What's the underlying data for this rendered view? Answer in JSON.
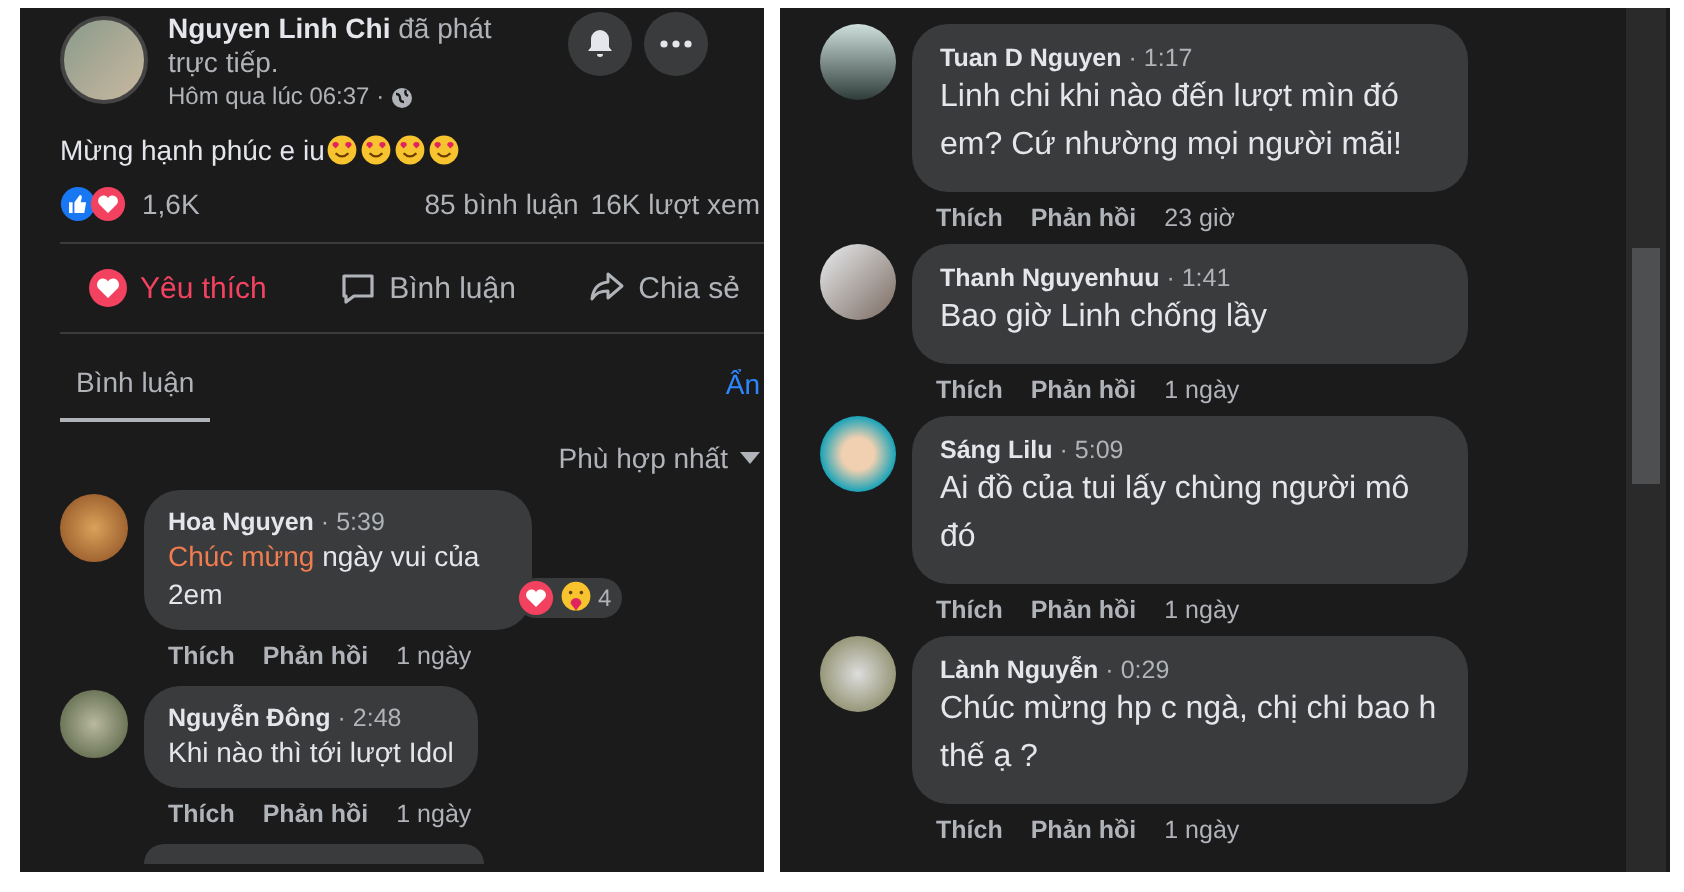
{
  "post": {
    "author": "Nguyen Linh Chi",
    "action": "đã phát trực tiếp.",
    "time": "Hôm qua lúc 06:37 ·",
    "text": "Mừng hạnh phúc e iu",
    "emojis": [
      {
        "kind": "smiling_hearts"
      },
      {
        "kind": "smiling_hearts"
      },
      {
        "kind": "smiling_hearts"
      },
      {
        "kind": "smiling_hearts"
      }
    ],
    "separator": "·",
    "reaction_count": "1,6K",
    "comment_count": "85 bình luận",
    "view_count": "16K lượt xem",
    "actions": [
      {
        "kind": "like",
        "label": "Yêu thích",
        "selected": true
      },
      {
        "kind": "comment",
        "label": "Bình luận",
        "selected": false
      },
      {
        "kind": "share",
        "label": "Chia sẻ",
        "selected": false
      }
    ],
    "tabs": [
      {
        "label": "Bình luận",
        "selected": true
      }
    ],
    "hide_link": "Ẩn",
    "sort": "Phù hợp nhất"
  },
  "left_comments": [
    {
      "name": "Hoa Nguyen",
      "time": "5:39",
      "parts": [
        {
          "text": "Chúc mừng",
          "highlighted": true
        },
        {
          "text": " ngày vui của 2em",
          "highlighted": false
        }
      ],
      "reaction_count": "4",
      "like": "Thích",
      "reply": "Phản hồi",
      "age": "1 ngày"
    },
    {
      "name": "Nguyễn Đông",
      "time": "2:48",
      "parts": [
        {
          "text": "Khi nào thì tới lượt Idol",
          "highlighted": false
        }
      ],
      "like": "Thích",
      "reply": "Phản hồi",
      "age": "1 ngày"
    }
  ],
  "right_comments": [
    {
      "name": "Tuan D Nguyen",
      "time": "1:17",
      "parts": [
        {
          "text": "Linh chi khi nào đến lượt mìn đó em? Cứ nhường mọi người mãi!",
          "highlighted": false
        }
      ],
      "like": "Thích",
      "reply": "Phản hồi",
      "age": "23 giờ"
    },
    {
      "name": "Thanh Nguyenhuu",
      "time": "1:41",
      "parts": [
        {
          "text": "Bao giờ Linh chống lầy",
          "highlighted": false
        }
      ],
      "like": "Thích",
      "reply": "Phản hồi",
      "age": "1 ngày"
    },
    {
      "name": "Sáng Lilu",
      "time": "5:09",
      "parts": [
        {
          "text": "Ai đồ của tui lấy chùng người mô đó",
          "highlighted": false
        }
      ],
      "like": "Thích",
      "reply": "Phản hồi",
      "age": "1 ngày"
    },
    {
      "name": "Lành Nguyễn",
      "time": "0:29",
      "parts": [
        {
          "text": "Chúc mừng hp c ngà, chị chi bao h thế ạ ?",
          "highlighted": false
        }
      ],
      "like": "Thích",
      "reply": "Phản hồi",
      "age": "1 ngày"
    }
  ]
}
